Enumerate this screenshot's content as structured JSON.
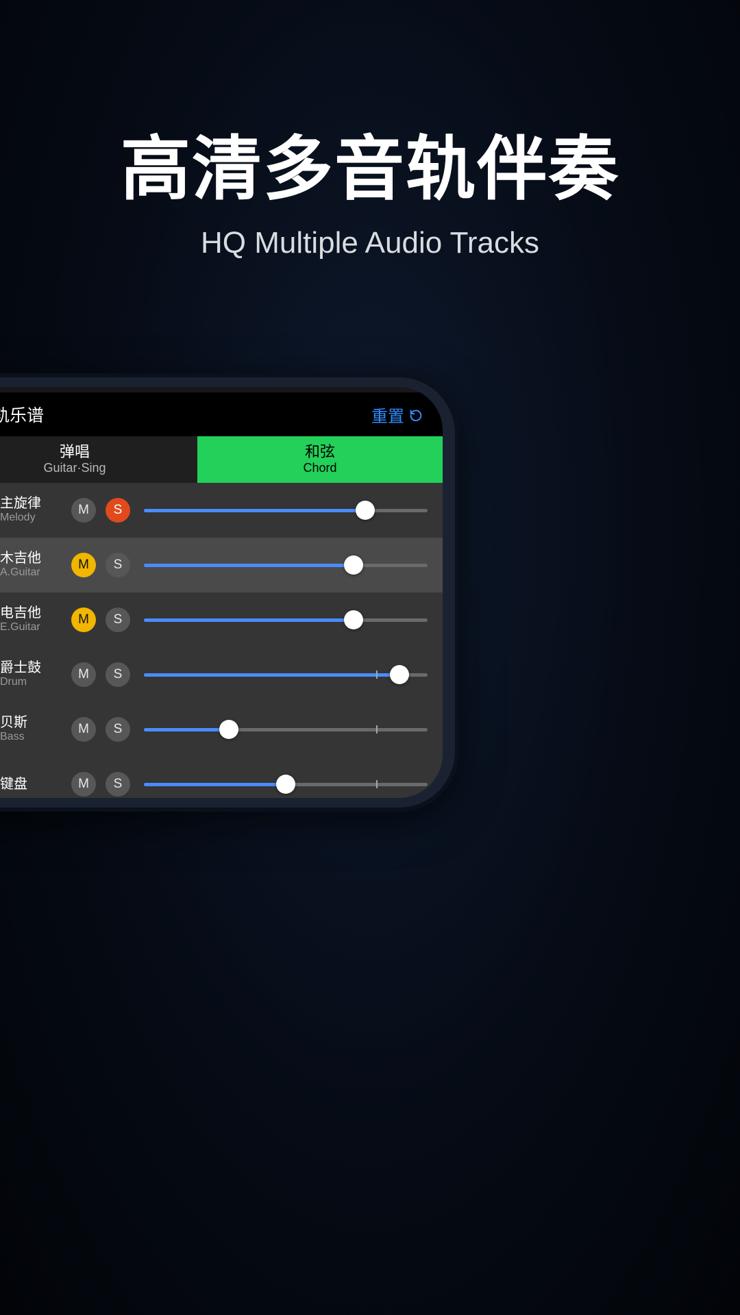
{
  "hero": {
    "title_cn": "高清多音轨伴奏",
    "title_en": "HQ Multiple Audio Tracks"
  },
  "topbar": {
    "title": "多轨乐谱",
    "reset_label": "重置"
  },
  "tabs": [
    {
      "cn": "弹唱",
      "en": "Guitar·Sing",
      "active": false
    },
    {
      "cn": "和弦",
      "en": "Chord",
      "active": true
    }
  ],
  "tracks": [
    {
      "icon": "person",
      "name_cn": "主旋律",
      "name_en": "Melody",
      "m_on": false,
      "s_on": true,
      "selected": false,
      "value": 78,
      "tick": 78
    },
    {
      "icon": "aguitar",
      "name_cn": "木吉他",
      "name_en": "A.Guitar",
      "m_on": true,
      "s_on": false,
      "selected": true,
      "value": 74,
      "tick": 74
    },
    {
      "icon": "eguitar",
      "name_cn": "电吉他",
      "name_en": "E.Guitar",
      "m_on": true,
      "s_on": false,
      "selected": false,
      "value": 74,
      "tick": 74
    },
    {
      "icon": "drum",
      "name_cn": "爵士鼓",
      "name_en": "Drum",
      "m_on": false,
      "s_on": false,
      "selected": false,
      "value": 90,
      "tick": 82
    },
    {
      "icon": "bass",
      "name_cn": "贝斯",
      "name_en": "Bass",
      "m_on": false,
      "s_on": false,
      "selected": false,
      "value": 30,
      "tick": 82
    },
    {
      "icon": "piano",
      "name_cn": "键盘",
      "name_en": "",
      "m_on": false,
      "s_on": false,
      "selected": false,
      "value": 50,
      "tick": 82
    }
  ],
  "ms_labels": {
    "mute": "M",
    "solo": "S"
  }
}
